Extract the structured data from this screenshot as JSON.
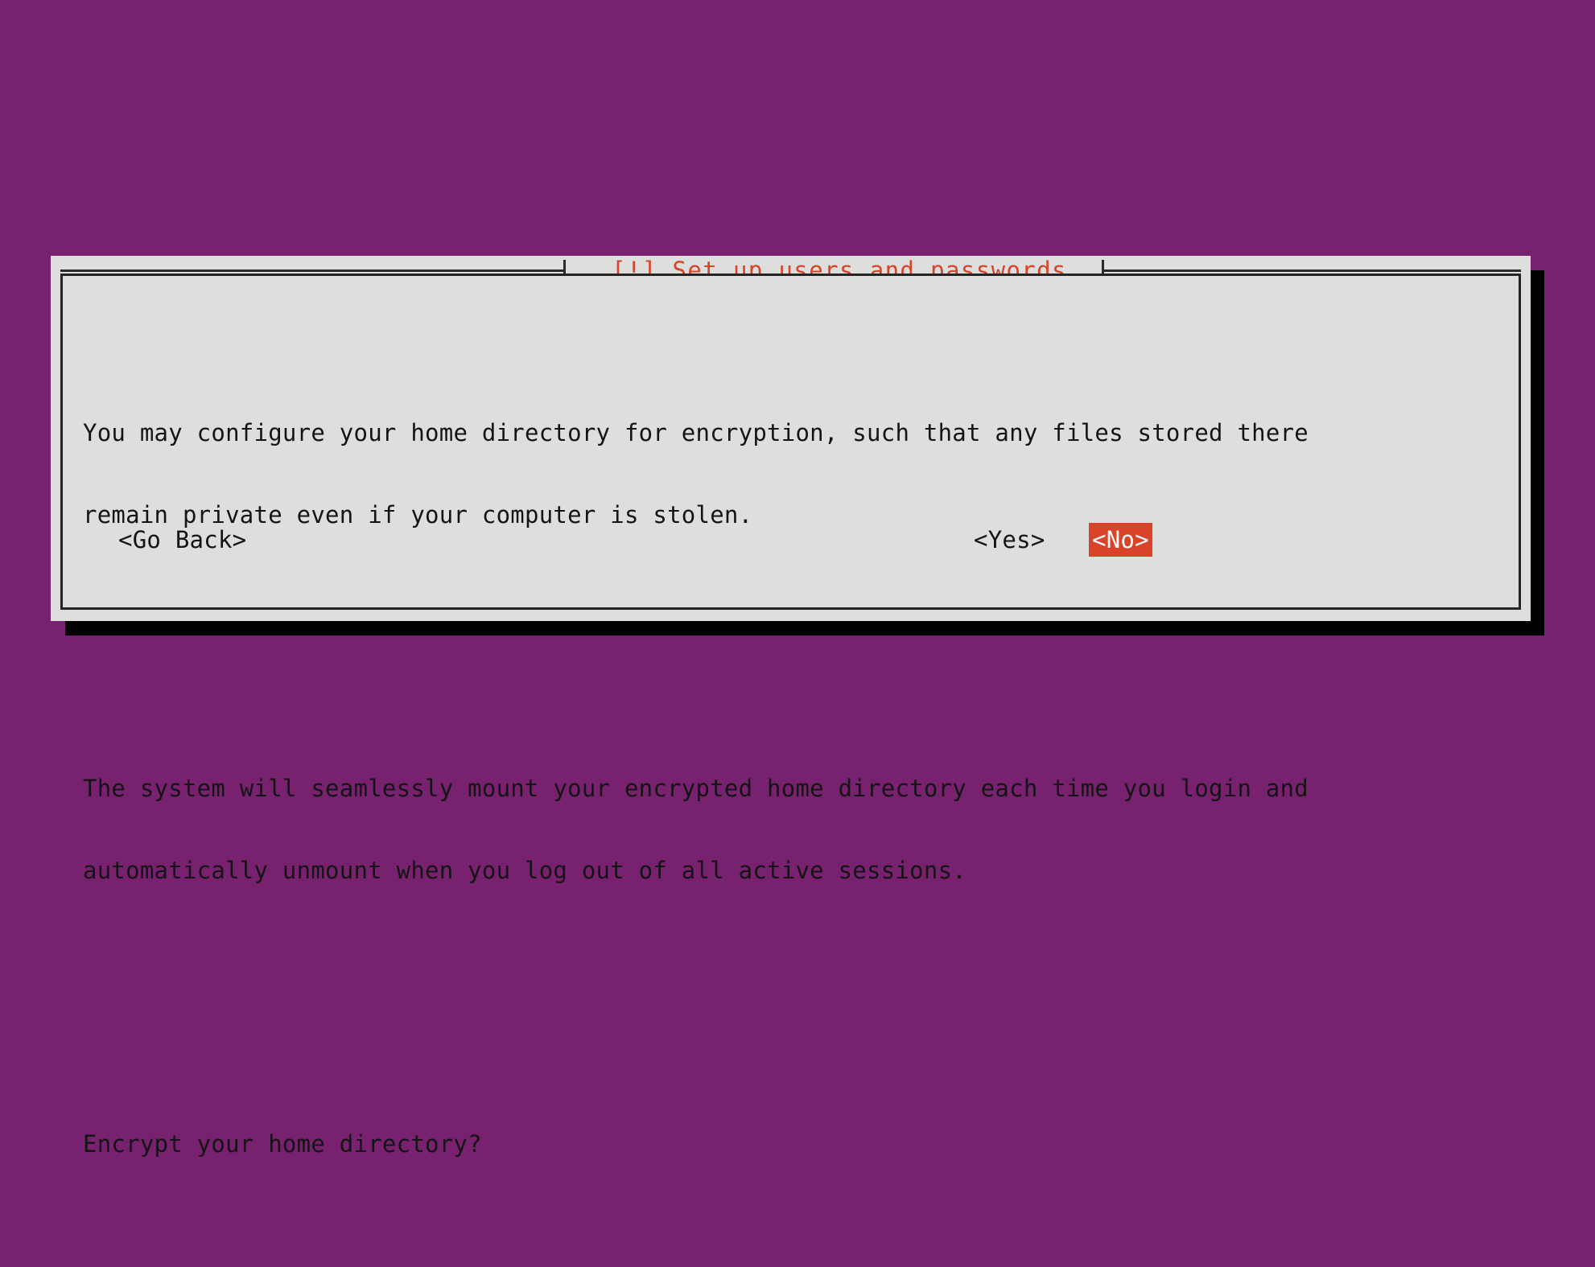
{
  "screen": {
    "background_color": "#77216f",
    "dialog_background_color": "#dededc",
    "border_color": "#242424",
    "accent_color": "#d8432a",
    "shadow_color": "#000000",
    "text_color": "#141414"
  },
  "dialog": {
    "title": "[!] Set up users and passwords",
    "paragraphs": [
      {
        "id": "intro",
        "lines": [
          "You may configure your home directory for encryption, such that any files stored there",
          "remain private even if your computer is stolen."
        ]
      },
      {
        "id": "behavior",
        "lines": [
          "The system will seamlessly mount your encrypted home directory each time you login and",
          "automatically unmount when you log out of all active sessions."
        ]
      },
      {
        "id": "question",
        "lines": [
          "Encrypt your home directory?"
        ]
      }
    ],
    "buttons": {
      "go_back": "<Go Back>",
      "yes": "<Yes>",
      "no": "<No>",
      "selected": "<No>"
    }
  }
}
